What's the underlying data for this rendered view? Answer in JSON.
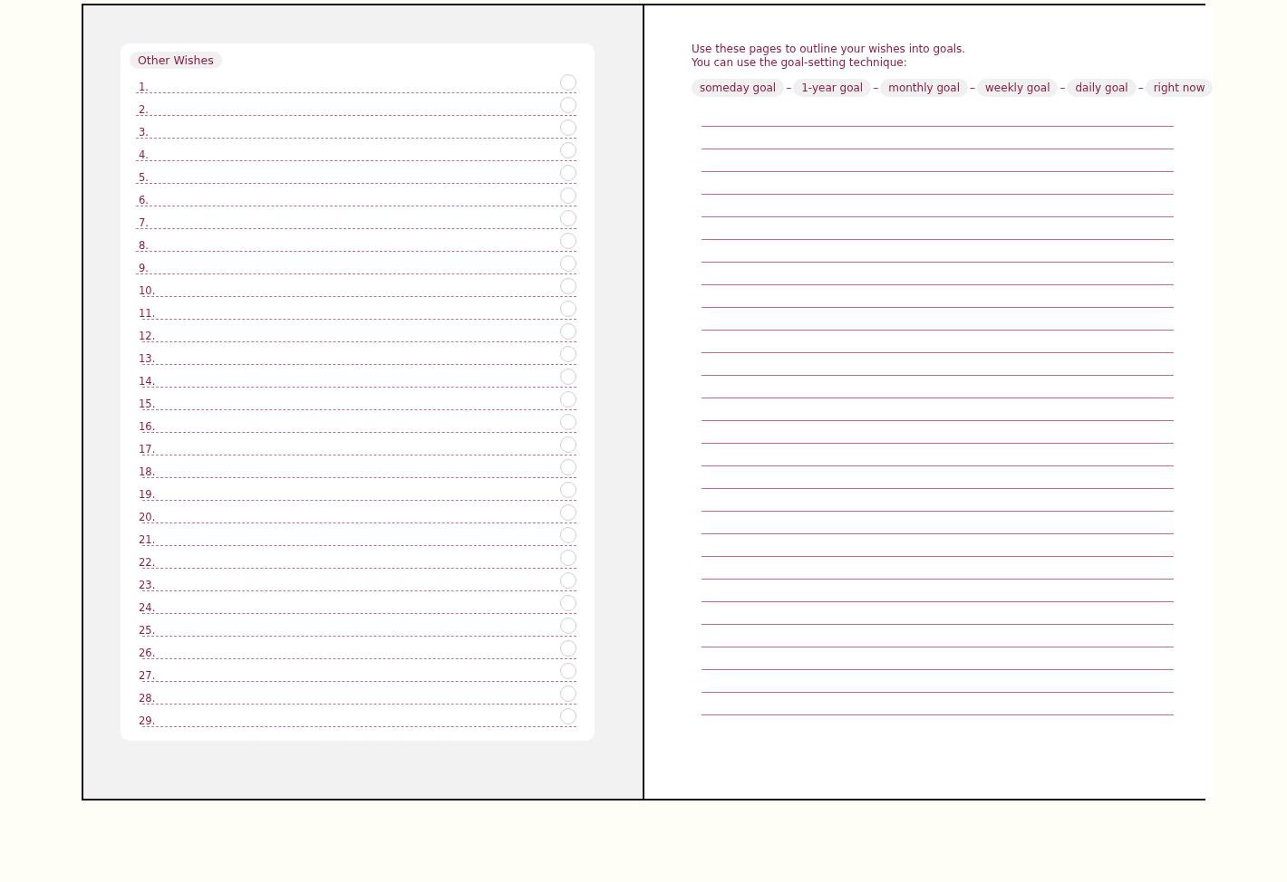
{
  "left_page": {
    "section_title": "Other Wishes",
    "wishes": [
      {
        "number": "1.",
        "checked": false
      },
      {
        "number": "2.",
        "checked": false
      },
      {
        "number": "3.",
        "checked": false
      },
      {
        "number": "4.",
        "checked": false
      },
      {
        "number": "5.",
        "checked": false
      },
      {
        "number": "6.",
        "checked": false
      },
      {
        "number": "7.",
        "checked": false
      },
      {
        "number": "8.",
        "checked": false
      },
      {
        "number": "9.",
        "checked": false
      },
      {
        "number": "10.",
        "checked": false
      },
      {
        "number": "11.",
        "checked": false
      },
      {
        "number": "12.",
        "checked": false
      },
      {
        "number": "13.",
        "checked": false
      },
      {
        "number": "14.",
        "checked": false
      },
      {
        "number": "15.",
        "checked": false
      },
      {
        "number": "16.",
        "checked": false
      },
      {
        "number": "17.",
        "checked": false
      },
      {
        "number": "18.",
        "checked": false
      },
      {
        "number": "19.",
        "checked": false
      },
      {
        "number": "20.",
        "checked": false
      },
      {
        "number": "21.",
        "checked": false
      },
      {
        "number": "22.",
        "checked": false
      },
      {
        "number": "23.",
        "checked": false
      },
      {
        "number": "24.",
        "checked": false
      },
      {
        "number": "25.",
        "checked": false
      },
      {
        "number": "26.",
        "checked": false
      },
      {
        "number": "27.",
        "checked": false
      },
      {
        "number": "28.",
        "checked": false
      },
      {
        "number": "29.",
        "checked": false
      }
    ]
  },
  "right_page": {
    "intro": [
      "Use these pages to outline your wishes into goals.",
      "You can use the goal-setting technique:"
    ],
    "goal_chain": [
      {
        "kind": "chip",
        "text": "someday goal"
      },
      {
        "kind": "separator",
        "text": "–"
      },
      {
        "kind": "chip",
        "text": "1-year goal"
      },
      {
        "kind": "separator",
        "text": "–"
      },
      {
        "kind": "chip",
        "text": "monthly goal"
      },
      {
        "kind": "separator",
        "text": "–"
      },
      {
        "kind": "chip",
        "text": "weekly goal"
      },
      {
        "kind": "separator",
        "text": "–"
      },
      {
        "kind": "chip",
        "text": "daily goal"
      },
      {
        "kind": "separator",
        "text": "–"
      },
      {
        "kind": "chip",
        "text": "right now"
      }
    ]
  }
}
